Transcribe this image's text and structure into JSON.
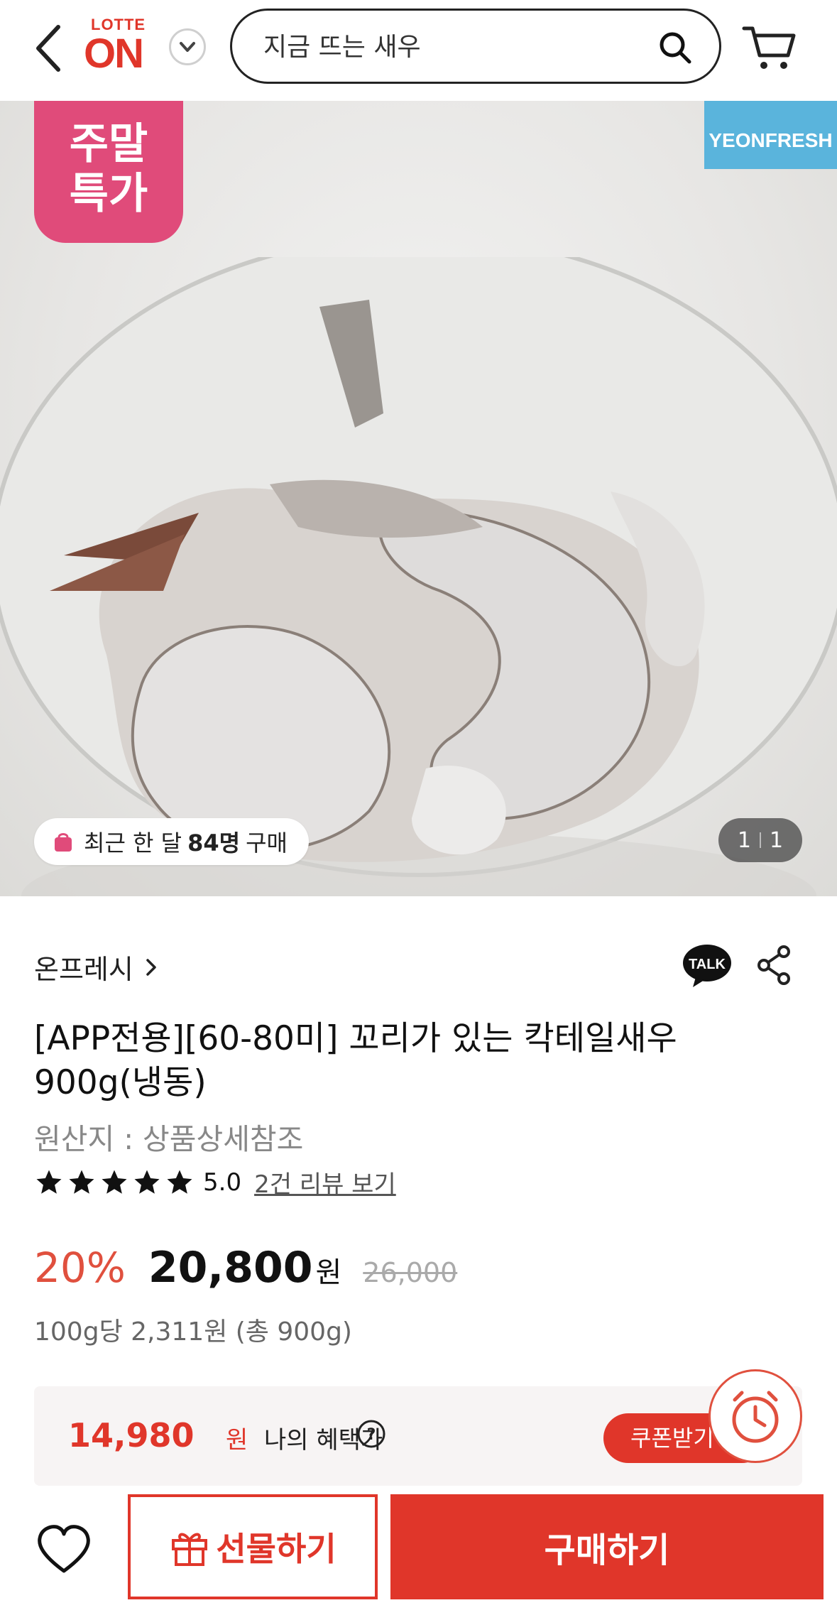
{
  "header": {
    "logo_top": "LOTTE",
    "logo_main": "ON",
    "search_placeholder": "지금 뜨는 새우"
  },
  "hero": {
    "badge_line1": "주말",
    "badge_line2": "특가",
    "brand_tag": "YEONFRESH",
    "buyers_prefix": "최근 한 달",
    "buyers_count": "84명",
    "buyers_suffix": "구매",
    "page_current": "1",
    "page_total": "1"
  },
  "product": {
    "seller": "온프레시",
    "title": "[APP전용][60-80미] 꼬리가 있는 칵테일새우 900g(냉동)",
    "origin": "원산지 : 상품상세참조",
    "rating": "5.0",
    "stars": 5,
    "review_link": "2건 리뷰 보기",
    "discount": "20%",
    "price": "20,800",
    "currency": "원",
    "original_price": "26,000",
    "unit_price": "100g당 2,311원 (총 900g)"
  },
  "benefit": {
    "price": "14,980",
    "currency": "원",
    "label": "나의 혜택가",
    "coupon_label": "쿠폰받기"
  },
  "actions": {
    "gift_label": "선물하기",
    "buy_label": "구매하기"
  },
  "colors": {
    "brand_red": "#e0362a",
    "badge_pink": "#e04b7a",
    "brand_blue": "#5ab4dc"
  }
}
